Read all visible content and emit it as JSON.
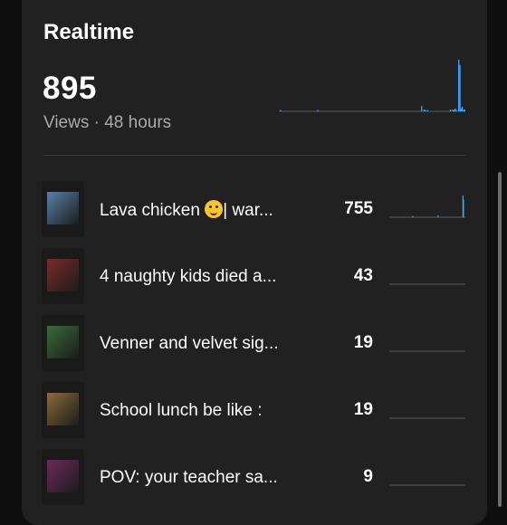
{
  "realtime": {
    "title": "Realtime",
    "total_views": "895",
    "subtitle": "Views · 48 hours",
    "sparkline": [
      0,
      1,
      0,
      0,
      0,
      0,
      0,
      0,
      0,
      0,
      0,
      0,
      0,
      0,
      0,
      0,
      0,
      0,
      0,
      0,
      0,
      0,
      0,
      0,
      0,
      0,
      0,
      0,
      0,
      0,
      0,
      0,
      1,
      0,
      0,
      0,
      0,
      0,
      0,
      0,
      0,
      0,
      0,
      0,
      0,
      0,
      0,
      0,
      0,
      0,
      0,
      0,
      0,
      0,
      0,
      0,
      0,
      0,
      0,
      0,
      0,
      0,
      0,
      0,
      0,
      0,
      0,
      0,
      0,
      0,
      0,
      0,
      0,
      0,
      0,
      0,
      0,
      0,
      0,
      0,
      0,
      0,
      0,
      0,
      0,
      0,
      0,
      0,
      0,
      0,
      0,
      0,
      0,
      0,
      0,
      0,
      0,
      0,
      0,
      0,
      0,
      0,
      0,
      0,
      0,
      0,
      0,
      0,
      0,
      0,
      0,
      0,
      0,
      0,
      0,
      0,
      0,
      0,
      0,
      6,
      0,
      2,
      1,
      0,
      1,
      0,
      0,
      0,
      0,
      0,
      0,
      0,
      0,
      0,
      0,
      0,
      0,
      0,
      0,
      0,
      0,
      0,
      0,
      2,
      0,
      2,
      1,
      3,
      1,
      0,
      58,
      52,
      3,
      5,
      1,
      2
    ],
    "accent_color": "#3ea6ff"
  },
  "videos": [
    {
      "title": "Lava chicken ",
      "emoji": "smiling-face-savoring-food-emoji",
      "title_suffix": "| war...",
      "views": "755",
      "thumb_color": "#5a7fa8",
      "sparkline": [
        0,
        0,
        0,
        0,
        0,
        0,
        0,
        0,
        0,
        0,
        0,
        0,
        0,
        0,
        0,
        0,
        0,
        0,
        0,
        0,
        0,
        0,
        0,
        0,
        0,
        0,
        0,
        0,
        0,
        0,
        0,
        0,
        0,
        0,
        0,
        0,
        0,
        0,
        0,
        0,
        0,
        0,
        0,
        0,
        0,
        0,
        0,
        1,
        0,
        0,
        0,
        0,
        0,
        0,
        0,
        0,
        0,
        0,
        0,
        0,
        0,
        0,
        0,
        0,
        0,
        0,
        0,
        0,
        0,
        0,
        0,
        0,
        0,
        0,
        0,
        0,
        0,
        0,
        0,
        0,
        0,
        0,
        0,
        0,
        0,
        0,
        0,
        0,
        0,
        0,
        0,
        0,
        0,
        0,
        0,
        0,
        0,
        0,
        0,
        2,
        0,
        0,
        0,
        0,
        0,
        0,
        0,
        0,
        0,
        0,
        0,
        0,
        0,
        0,
        0,
        0,
        0,
        0,
        0,
        0,
        0,
        0,
        0,
        0,
        0,
        0,
        0,
        0,
        0,
        0,
        0,
        0,
        0,
        0,
        0,
        0,
        0,
        0,
        0,
        0,
        0,
        0,
        0,
        0,
        0,
        0,
        0,
        0,
        0,
        0,
        22,
        18,
        0,
        0,
        0,
        0
      ]
    },
    {
      "title": "4 naughty kids died a...",
      "views": "43",
      "thumb_color": "#7a2a2a",
      "sparkline": []
    },
    {
      "title": "Venner and velvet sig...",
      "views": "19",
      "thumb_color": "#3a6b3a",
      "sparkline": []
    },
    {
      "title": "School lunch be like :",
      "views": "19",
      "thumb_color": "#8a6a3a",
      "sparkline": []
    },
    {
      "title": "POV: your teacher sa...",
      "views": "9",
      "thumb_color": "#6a2a5a",
      "sparkline": []
    }
  ]
}
